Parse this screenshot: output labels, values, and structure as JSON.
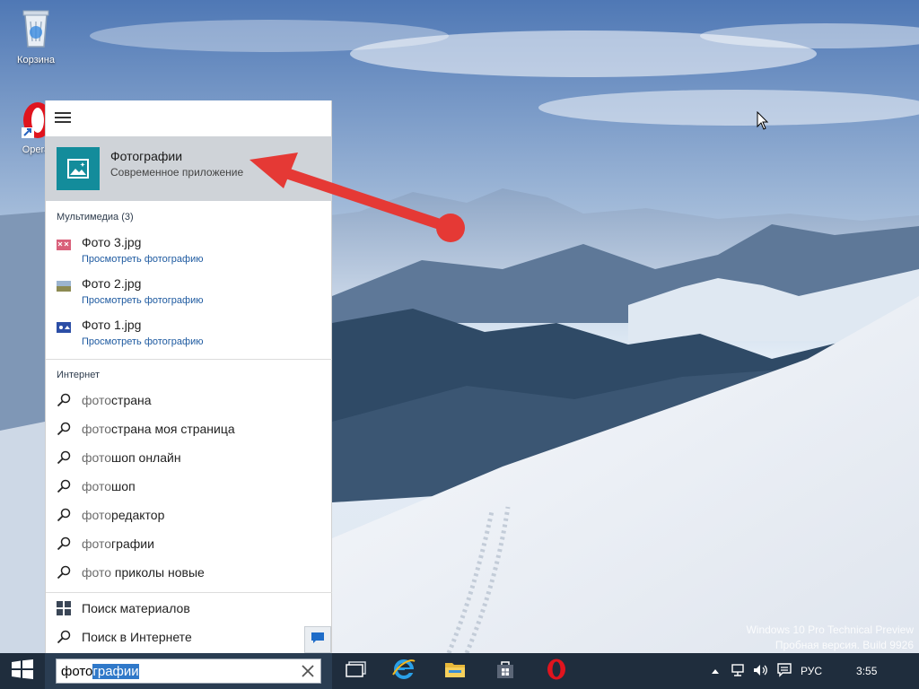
{
  "desktop": {
    "icons": [
      {
        "label": "Корзина"
      },
      {
        "label": "Opera"
      }
    ],
    "watermark": {
      "line1": "Windows 10 Pro Technical Preview",
      "line2": "Пробная версия. Build 9926"
    }
  },
  "search_panel": {
    "best_match": {
      "title_typed": "Фото",
      "title_rest": "графии",
      "subtitle": "Современное приложение"
    },
    "media_group": {
      "heading": "Мультимедиа (3)",
      "items": [
        {
          "name": "Фото 3.jpg",
          "action": "Просмотреть фотографию"
        },
        {
          "name": "Фото 2.jpg",
          "action": "Просмотреть фотографию"
        },
        {
          "name": "Фото 1.jpg",
          "action": "Просмотреть фотографию"
        }
      ]
    },
    "web_group": {
      "heading": "Интернет",
      "suggestions": [
        {
          "typed": "фото",
          "rest": "страна"
        },
        {
          "typed": "фото",
          "rest": "страна моя страница"
        },
        {
          "typed": "фото",
          "rest": "шоп онлайн"
        },
        {
          "typed": "фото",
          "rest": "шоп"
        },
        {
          "typed": "фото",
          "rest": "редактор"
        },
        {
          "typed": "фото",
          "rest": "графии"
        },
        {
          "typed": "фото",
          "rest": " приколы новые"
        }
      ]
    },
    "bottom": {
      "search_content": "Поиск материалов",
      "search_web": "Поиск в Интернете"
    }
  },
  "taskbar": {
    "search": {
      "typed": "фото",
      "autocomplete": "графии"
    },
    "tray": {
      "language": "РУС",
      "clock": "3:55"
    }
  },
  "colors": {
    "taskbar": "#1f2d3d",
    "app_tile": "#138c9b",
    "best_match_bg": "#cfd3d8",
    "arrow": "#e53935",
    "selection": "#3079c9"
  }
}
